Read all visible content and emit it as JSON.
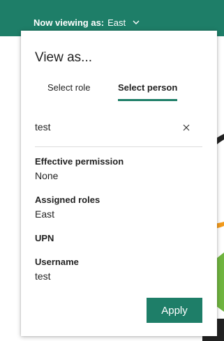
{
  "header": {
    "label": "Now viewing as:",
    "value": "East"
  },
  "panel": {
    "title": "View as...",
    "tabs": [
      {
        "label": "Select role",
        "selected": false
      },
      {
        "label": "Select person",
        "selected": true
      }
    ],
    "search_value": "test",
    "fields": [
      {
        "label": "Effective permission",
        "value": "None"
      },
      {
        "label": "Assigned roles",
        "value": "East"
      },
      {
        "label": "UPN",
        "value": ""
      },
      {
        "label": "Username",
        "value": "test"
      }
    ],
    "apply_label": "Apply"
  },
  "colors": {
    "accent": "#1e7e68"
  }
}
